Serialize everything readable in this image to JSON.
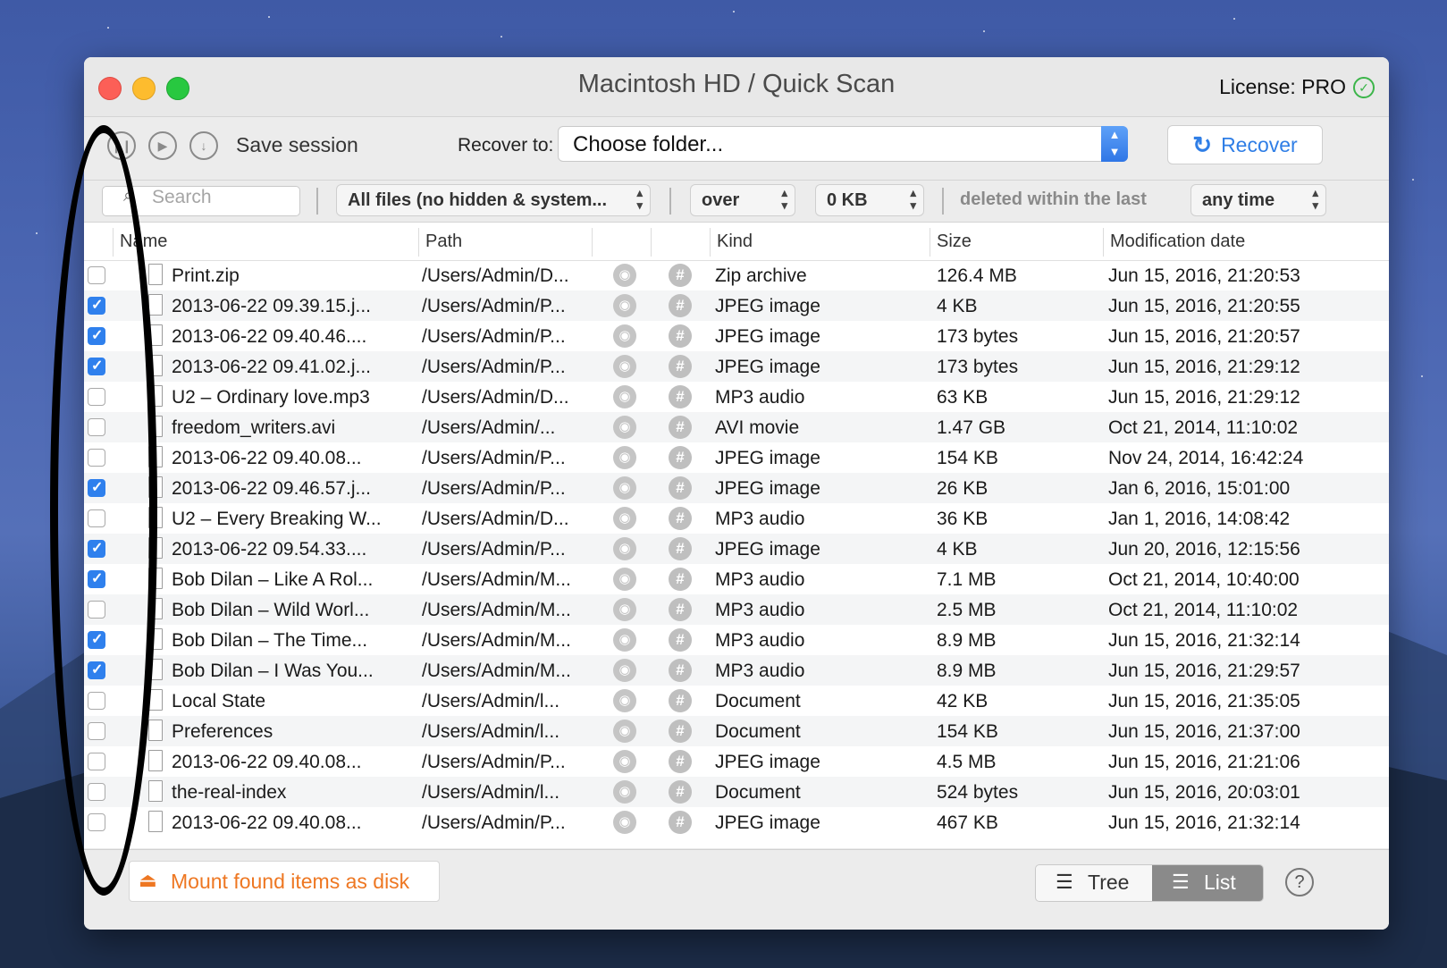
{
  "window": {
    "title": "Macintosh HD / Quick Scan",
    "license": "License: PRO",
    "license_icon": "check-circle-icon"
  },
  "toolbar": {
    "save_session_label": "Save session",
    "recover_to_label": "Recover to:",
    "folder_value": "Choose folder...",
    "recover_label": "Recover"
  },
  "filters": {
    "search_placeholder": "Search",
    "file_filter": "All files (no hidden & system...",
    "size_operator": "over",
    "size_value": "0 KB",
    "deleted_label": "deleted within the last",
    "time_range": "any time"
  },
  "table": {
    "columns": [
      "Name",
      "Path",
      "Kind",
      "Size",
      "Modification date"
    ],
    "rows": [
      {
        "checked": false,
        "name": "Print.zip",
        "path": "/Users/Admin/D...",
        "kind": "Zip archive",
        "size": "126.4 MB",
        "date": "Jun 15, 2016, 21:20:53"
      },
      {
        "checked": true,
        "name": "2013-06-22 09.39.15.j...",
        "path": "/Users/Admin/P...",
        "kind": "JPEG image",
        "size": "4 KB",
        "date": "Jun 15, 2016, 21:20:55"
      },
      {
        "checked": true,
        "name": "2013-06-22 09.40.46....",
        "path": "/Users/Admin/P...",
        "kind": "JPEG image",
        "size": "173 bytes",
        "date": "Jun 15, 2016, 21:20:57"
      },
      {
        "checked": true,
        "name": "2013-06-22 09.41.02.j...",
        "path": "/Users/Admin/P...",
        "kind": "JPEG image",
        "size": "173 bytes",
        "date": "Jun 15, 2016, 21:29:12"
      },
      {
        "checked": false,
        "name": "U2 – Ordinary love.mp3",
        "path": "/Users/Admin/D...",
        "kind": "MP3 audio",
        "size": "63 KB",
        "date": "Jun 15, 2016, 21:29:12"
      },
      {
        "checked": false,
        "name": "freedom_writers.avi",
        "path": "/Users/Admin/...",
        "kind": "AVI movie",
        "size": "1.47 GB",
        "date": "Oct 21, 2014, 11:10:02"
      },
      {
        "checked": false,
        "name": "2013-06-22 09.40.08...",
        "path": "/Users/Admin/P...",
        "kind": "JPEG image",
        "size": "154 KB",
        "date": "Nov 24, 2014, 16:42:24"
      },
      {
        "checked": true,
        "name": "2013-06-22 09.46.57.j...",
        "path": "/Users/Admin/P...",
        "kind": "JPEG image",
        "size": "26 KB",
        "date": "Jan 6, 2016, 15:01:00"
      },
      {
        "checked": false,
        "name": "U2 – Every Breaking W...",
        "path": "/Users/Admin/D...",
        "kind": "MP3 audio",
        "size": "36 KB",
        "date": "Jan 1, 2016, 14:08:42"
      },
      {
        "checked": true,
        "name": "2013-06-22 09.54.33....",
        "path": "/Users/Admin/P...",
        "kind": "JPEG image",
        "size": "4 KB",
        "date": "Jun 20, 2016, 12:15:56"
      },
      {
        "checked": true,
        "name": "Bob Dilan – Like A Rol...",
        "path": "/Users/Admin/M...",
        "kind": "MP3 audio",
        "size": "7.1 MB",
        "date": "Oct 21, 2014, 10:40:00"
      },
      {
        "checked": false,
        "name": "Bob Dilan – Wild Worl...",
        "path": "/Users/Admin/M...",
        "kind": "MP3 audio",
        "size": "2.5 MB",
        "date": "Oct 21, 2014, 11:10:02"
      },
      {
        "checked": true,
        "name": "Bob Dilan – The Time...",
        "path": "/Users/Admin/M...",
        "kind": "MP3 audio",
        "size": "8.9 MB",
        "date": "Jun 15, 2016, 21:32:14"
      },
      {
        "checked": true,
        "name": "Bob Dilan – I Was You...",
        "path": "/Users/Admin/M...",
        "kind": "MP3 audio",
        "size": "8.9 MB",
        "date": "Jun 15, 2016, 21:29:57"
      },
      {
        "checked": false,
        "name": "Local State",
        "path": "/Users/Admin/l...",
        "kind": "Document",
        "size": "42 KB",
        "date": "Jun 15, 2016, 21:35:05"
      },
      {
        "checked": false,
        "name": "Preferences",
        "path": "/Users/Admin/l...",
        "kind": "Document",
        "size": "154 KB",
        "date": "Jun 15, 2016, 21:37:00"
      },
      {
        "checked": false,
        "name": "2013-06-22 09.40.08...",
        "path": "/Users/Admin/P...",
        "kind": "JPEG image",
        "size": "4.5 MB",
        "date": "Jun 15, 2016, 21:21:06"
      },
      {
        "checked": false,
        "name": "the-real-index",
        "path": "/Users/Admin/l...",
        "kind": "Document",
        "size": "524 bytes",
        "date": "Jun 15, 2016, 20:03:01"
      },
      {
        "checked": false,
        "name": "2013-06-22 09.40.08...",
        "path": "/Users/Admin/P...",
        "kind": "JPEG image",
        "size": "467 KB",
        "date": "Jun 15, 2016, 21:32:14"
      }
    ]
  },
  "footer": {
    "mount_label": "Mount found items as disk",
    "tree_label": "Tree",
    "list_label": "List",
    "help": "?"
  },
  "colors": {
    "accent_blue": "#2f7ee6",
    "mount_orange": "#ee7722",
    "annotation": "#000000"
  }
}
